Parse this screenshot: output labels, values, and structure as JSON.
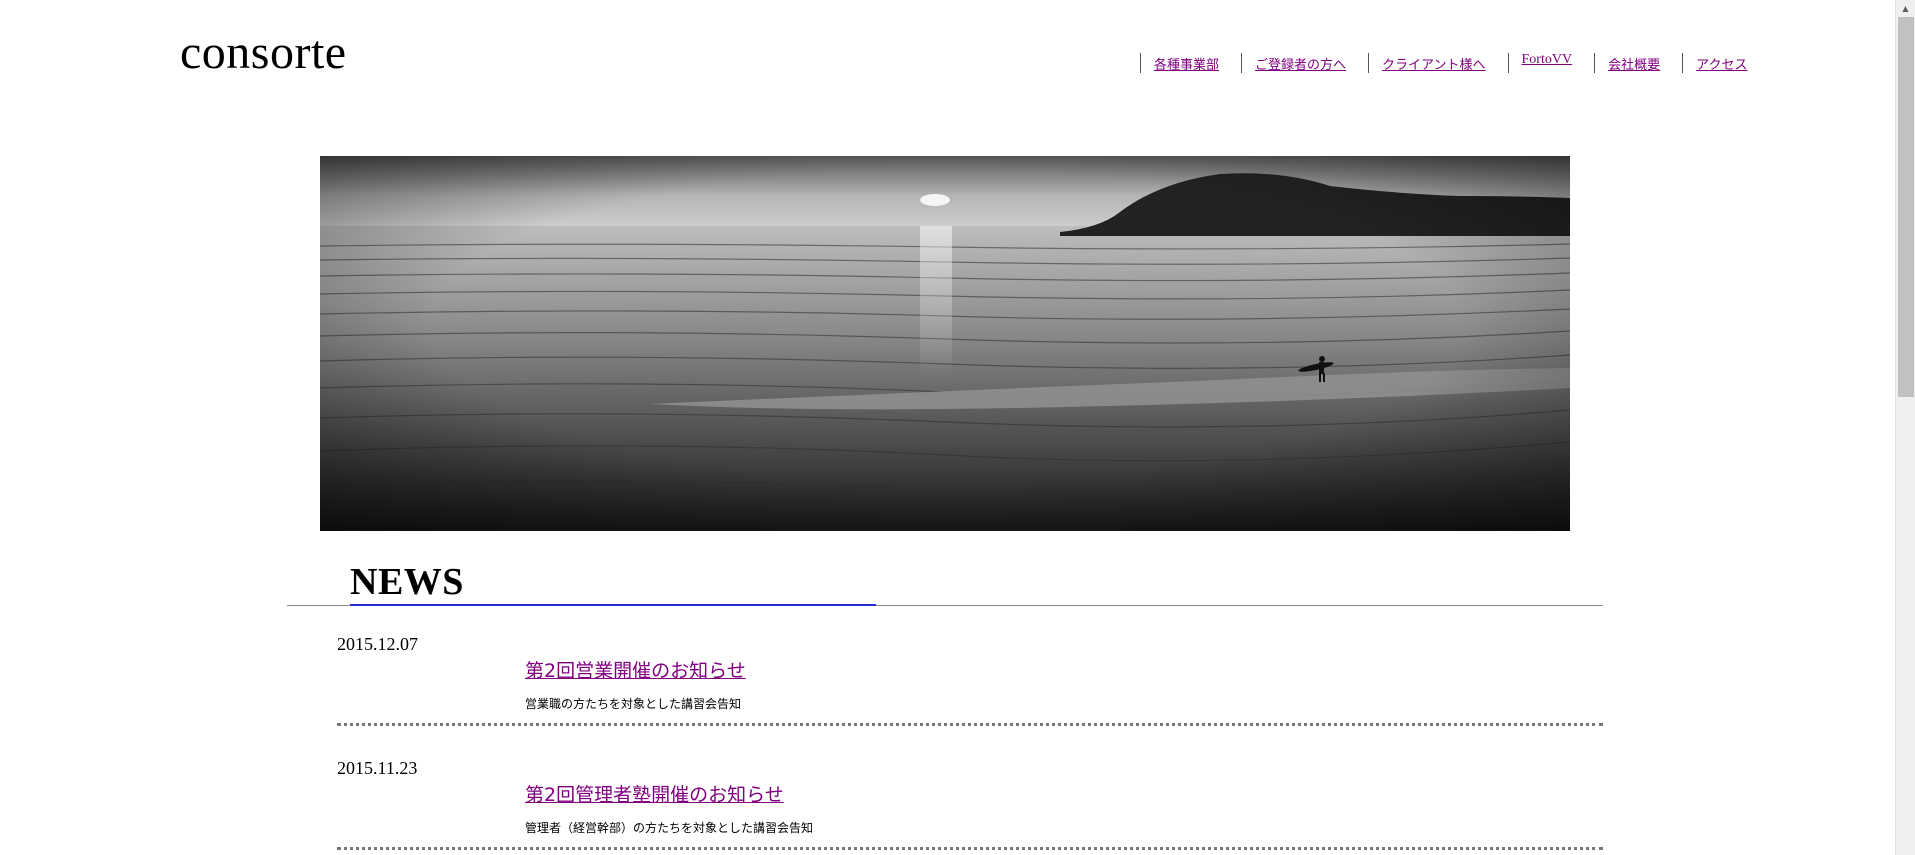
{
  "site": {
    "logo": "consorte"
  },
  "nav": {
    "items": [
      {
        "label": "各種事業部"
      },
      {
        "label": "ご登録者の方へ"
      },
      {
        "label": "クライアント様へ"
      },
      {
        "label": "FortoVV"
      },
      {
        "label": "会社概要"
      },
      {
        "label": "アクセス"
      }
    ]
  },
  "hero": {
    "image": "black-and-white beach sunset with island and surfer"
  },
  "news": {
    "title": "NEWS",
    "items": [
      {
        "date": "2015.12.07",
        "title": "第2回営業開催のお知らせ",
        "description": "営業職の方たちを対象とした講習会告知"
      },
      {
        "date": "2015.11.23",
        "title": "第2回管理者塾開催のお知らせ",
        "description": "管理者（経営幹部）の方たちを対象とした講習会告知"
      }
    ]
  },
  "colors": {
    "link": "#800080",
    "accent": "#2a2ad0",
    "text": "#000000"
  },
  "icons": {
    "scroll_up": "chevron-up-icon"
  }
}
